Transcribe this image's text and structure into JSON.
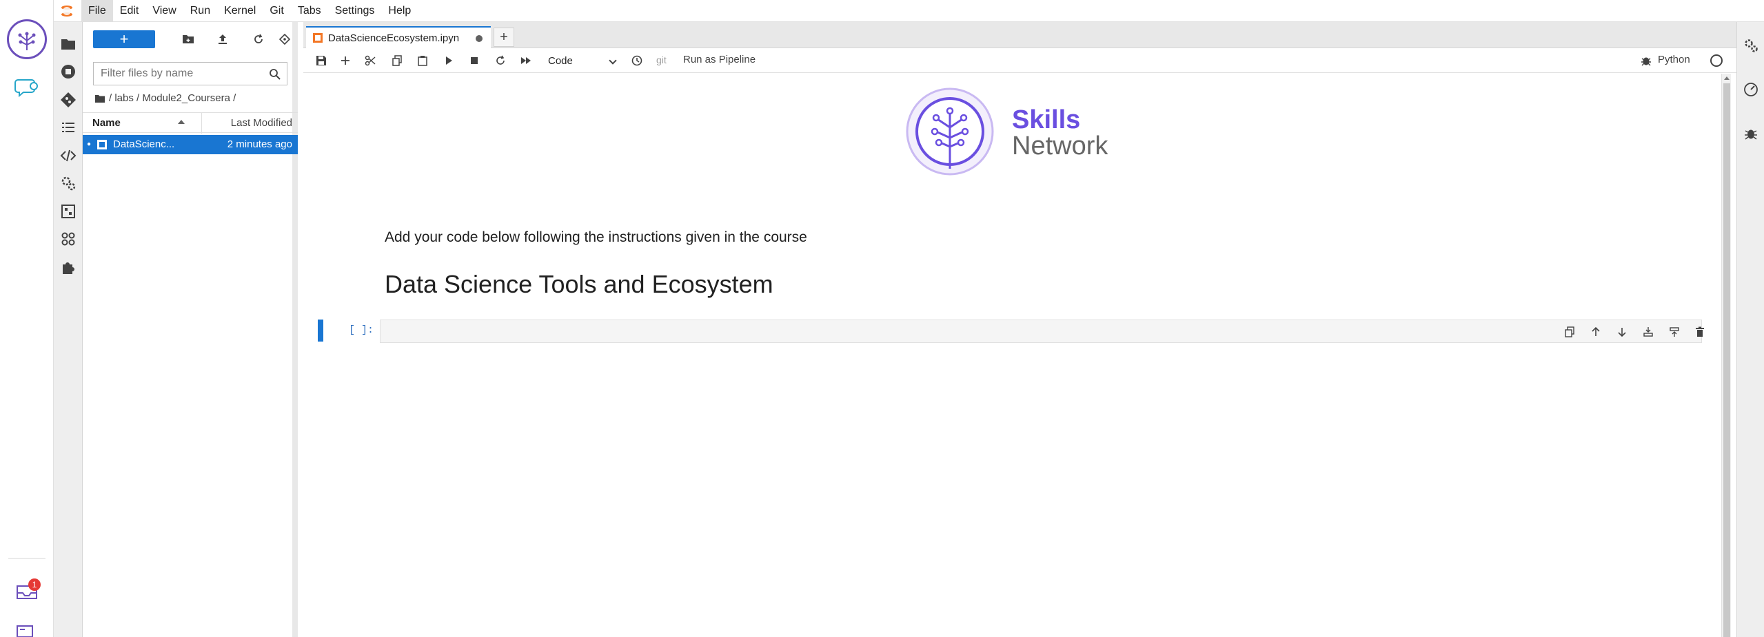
{
  "menubar": {
    "items": [
      "File",
      "Edit",
      "View",
      "Run",
      "Kernel",
      "Git",
      "Tabs",
      "Settings",
      "Help"
    ]
  },
  "outer_rail": {
    "notification_count": "1"
  },
  "filebrowser": {
    "new_label": "+",
    "filter_placeholder": "Filter files by name",
    "breadcrumb": "/ labs / Module2_Coursera /",
    "columns": {
      "name": "Name",
      "modified": "Last Modified"
    },
    "files": [
      {
        "name": "DataScienc...",
        "modified": "2 minutes ago",
        "selected": true
      }
    ]
  },
  "tabs": {
    "active": "DataScienceEcosystem.ipyn",
    "add_label": "+"
  },
  "notebook_toolbar": {
    "cell_type": "Code",
    "git_label": "git",
    "pipeline_label": "Run as Pipeline",
    "kernel_name": "Python"
  },
  "notebook": {
    "logo_text_1": "Skills",
    "logo_text_2": "Network",
    "markdown_text": "Add your code below following the instructions given in the course",
    "heading": "Data Science Tools and Ecosystem",
    "cell_prompt": "[ ]:"
  },
  "colors": {
    "accent": "#1976d2",
    "brand_purple": "#6a4fe0",
    "badge": "#e53935"
  }
}
